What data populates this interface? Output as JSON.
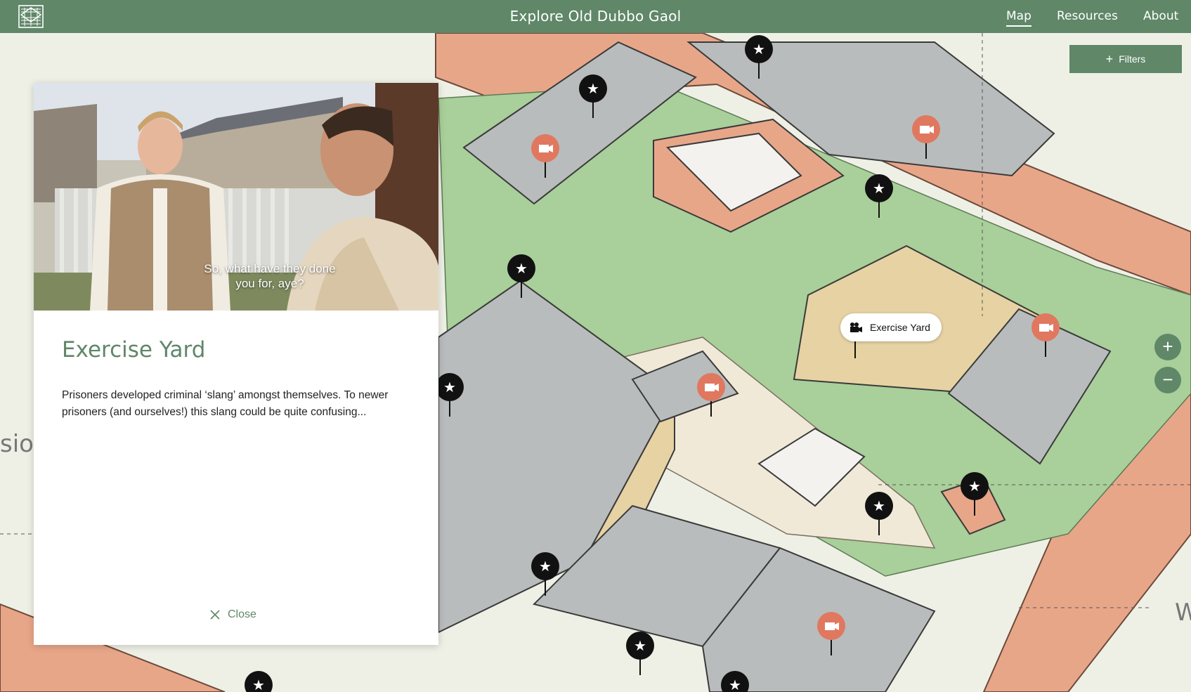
{
  "header": {
    "title": "Explore Old Dubbo Gaol",
    "nav": [
      {
        "label": "Map",
        "active": true
      },
      {
        "label": "Resources",
        "active": false
      },
      {
        "label": "About",
        "active": false
      }
    ],
    "logo_icon": "gaol-building-logo-icon"
  },
  "map": {
    "filters_label": "Filters",
    "filters_icon": "plus-icon",
    "zoom_in_icon": "plus-icon",
    "zoom_out_icon": "minus-icon",
    "tooltip": {
      "label": "Exercise Yard",
      "icon": "video-camera-icon"
    },
    "edge_text_left": "sion",
    "edge_text_right": "W",
    "colors": {
      "grass": "#a9cf9a",
      "brick": "#e8a689",
      "roof": "#b9bcbc",
      "path": "#f1e9d8",
      "sand": "#e6d2a3",
      "video_marker": "#e0785f",
      "star_marker": "#111111"
    }
  },
  "panel": {
    "caption": "So, what have they done you for, aye?",
    "title": "Exercise Yard",
    "body": "Prisoners developed criminal ‘slang’ amongst themselves. To newer prisoners (and ourselves!) this slang could be quite confusing...",
    "close_label": "Close",
    "close_icon": "close-icon"
  },
  "theme": {
    "header_bg": "#5f8768",
    "accent": "#5f8768"
  }
}
